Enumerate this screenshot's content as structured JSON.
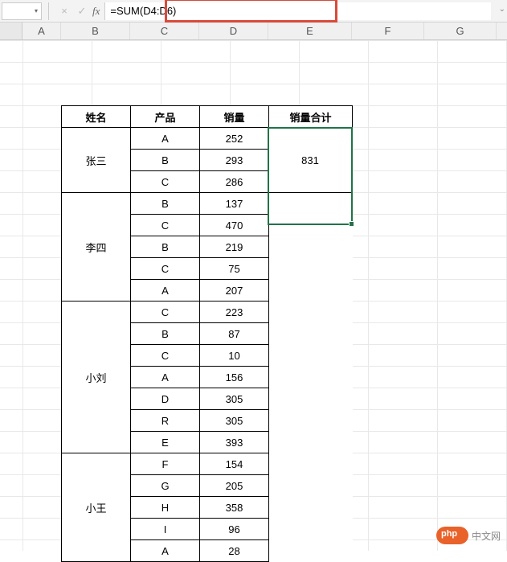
{
  "formula_bar": {
    "fx_label": "fx",
    "formula": "=SUM(D4:D6)",
    "cancel_icon": "×",
    "confirm_icon": "✓",
    "name_box_arrow": "▾",
    "expand_icon": "⌄"
  },
  "columns": [
    "A",
    "B",
    "C",
    "D",
    "E",
    "F",
    "G"
  ],
  "table": {
    "headers": {
      "name": "姓名",
      "product": "产品",
      "sales": "销量",
      "total": "销量合计"
    },
    "groups": [
      {
        "person": "张三",
        "rows": [
          {
            "product": "A",
            "sales": 252
          },
          {
            "product": "B",
            "sales": 293
          },
          {
            "product": "C",
            "sales": 286
          }
        ],
        "total": 831
      },
      {
        "person": "李四",
        "rows": [
          {
            "product": "B",
            "sales": 137
          },
          {
            "product": "C",
            "sales": 470
          },
          {
            "product": "B",
            "sales": 219
          },
          {
            "product": "C",
            "sales": 75
          },
          {
            "product": "A",
            "sales": 207
          }
        ]
      },
      {
        "person": "小刘",
        "rows": [
          {
            "product": "C",
            "sales": 223
          },
          {
            "product": "B",
            "sales": 87
          },
          {
            "product": "C",
            "sales": 10
          },
          {
            "product": "A",
            "sales": 156
          },
          {
            "product": "D",
            "sales": 305
          },
          {
            "product": "R",
            "sales": 305
          },
          {
            "product": "E",
            "sales": 393
          }
        ]
      },
      {
        "person": "小王",
        "rows": [
          {
            "product": "F",
            "sales": 154
          },
          {
            "product": "G",
            "sales": 205
          },
          {
            "product": "H",
            "sales": 358
          },
          {
            "product": "I",
            "sales": 96
          },
          {
            "product": "A",
            "sales": 28
          }
        ]
      }
    ]
  },
  "watermark": {
    "text": "中文网"
  }
}
